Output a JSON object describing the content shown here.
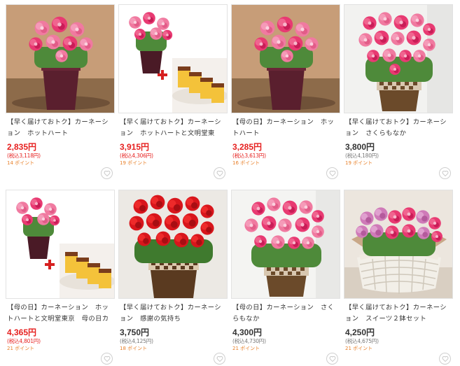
{
  "products": [
    {
      "title": "【早く届けておトク】カーネーション　ホットハート",
      "price": "2,835円",
      "tax": "(税込3,118円)",
      "points": "14 ポイント"
    },
    {
      "title": "【早く届けておトク】カーネーション　ホットハートと文明堂東京　…",
      "price": "3,915円",
      "tax": "(税込4,306円)",
      "points": "19 ポイント"
    },
    {
      "title": "【母の日】カーネーション　ホットハート",
      "price": "3,285円",
      "tax": "(税込3,613円)",
      "points": "16 ポイント"
    },
    {
      "title": "【早く届けておトク】カーネーション　さくらもなか",
      "price": "3,800円",
      "tax": "(税込4,180円)",
      "points": "19 ポイント"
    },
    {
      "title": "【母の日】カーネーション　ホットハートと文明堂東京　母の日カス…",
      "price": "4,365円",
      "tax": "(税込4,801円)",
      "points": "21 ポイント"
    },
    {
      "title": "【早く届けておトク】カーネーション　感謝の気持ち",
      "price": "3,750円",
      "tax": "(税込4,125円)",
      "points": "18 ポイント"
    },
    {
      "title": "【母の日】カーネーション　さくらもなか",
      "price": "4,300円",
      "tax": "(税込4,730円)",
      "points": "21 ポイント"
    },
    {
      "title": "【早く届けておトク】カーネーション　スイーツ２鉢セット",
      "price": "4,250円",
      "tax": "(税込4,675円)",
      "points": "21 ポイント"
    }
  ],
  "colors": {
    "price_red": "#e6201f",
    "points_orange": "#e8802a"
  }
}
